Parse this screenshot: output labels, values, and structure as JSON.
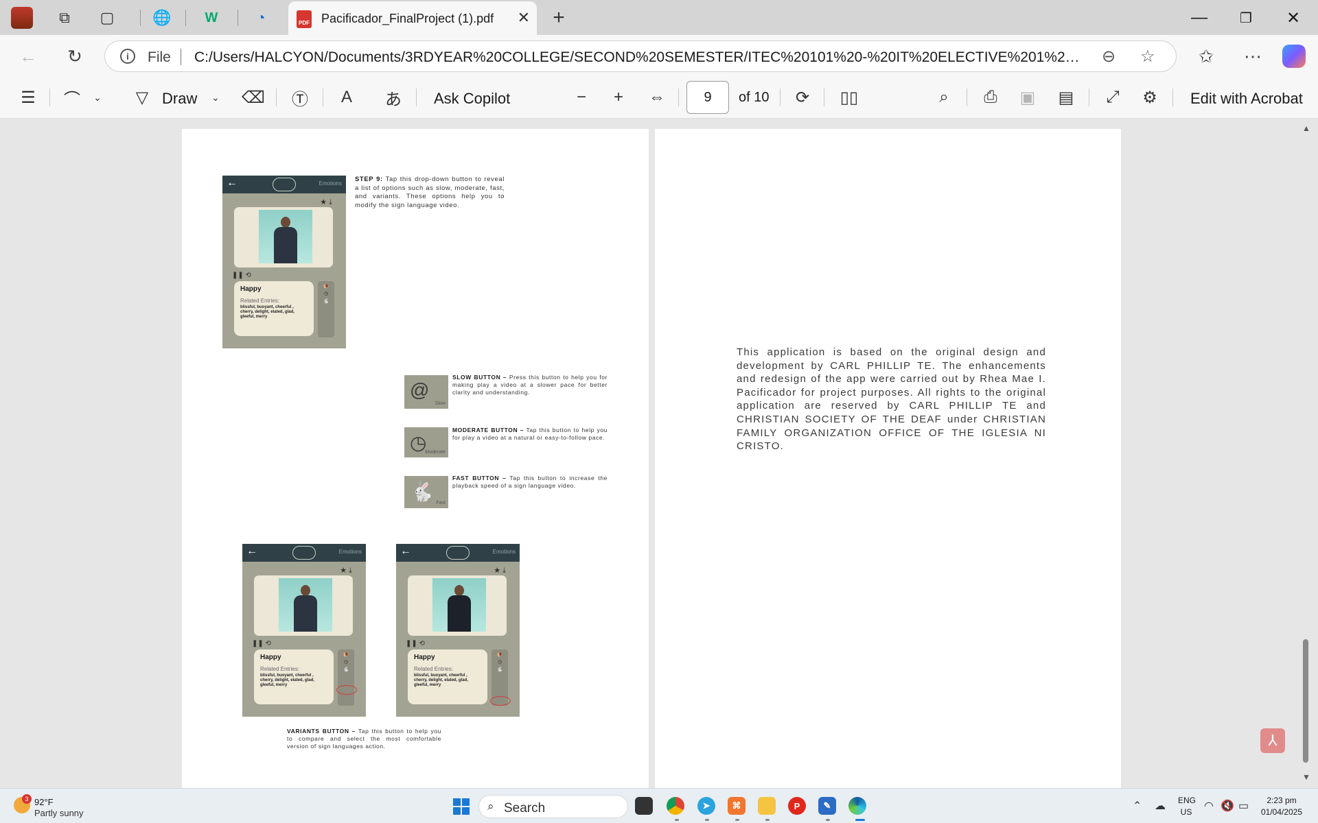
{
  "tab": {
    "title": "Pacificador_FinalProject (1).pdf",
    "close": "✕",
    "new_tab": "+"
  },
  "address": {
    "file_label": "File",
    "url": "C:/Users/HALCYON/Documents/3RDYEAR%20COLLEGE/SECOND%20SEMESTER/ITEC%20101%20-%20IT%20ELECTIVE%201%20(HUMAN..."
  },
  "pdf_toolbar": {
    "draw_label": "Draw",
    "ask_copilot": "Ask Copilot",
    "page_current": "9",
    "page_total": "of 10",
    "edit_acrobat": "Edit with Acrobat"
  },
  "page_left": {
    "phone_header_label": "Emotions",
    "card_title": "Happy",
    "card_sub": "Related Entries:",
    "card_words": "blissful, buoyant, cheerful , cherry, delight, elated, glad, gleeful, merry",
    "step9_label": "STEP 9:",
    "step9_text": " Tap this drop-down button to reveal a list of options such as slow, moderate, fast, and variants. These options help you to modify the sign language video.",
    "slow_label": "SLOW BUTTON –",
    "slow_text": " Press this button  to help you for  making play a video at a slower pace for better clarity and understanding.",
    "slow_thumb": "Slow",
    "moderate_label": "MODERATE BUTTON –",
    "moderate_text": " Tap this button  to help you for play a video at a natural or easy-to-follow pace.",
    "moderate_thumb": "Moderate",
    "fast_label": "FAST BUTTON –",
    "fast_text": " Tap this button  to increase the playback speed of a sign language video.",
    "fast_thumb": "Fast",
    "variants_label": "VARIANTS BUTTON –",
    "variants_text": " Tap this button  to help you to compare and select the most comfortable version of sign languages action."
  },
  "page_right": {
    "credit": "This application is based on the original design and development by CARL PHILLIP TE. The enhancements and redesign of the app were carried out by Rhea Mae I. Pacificador for project purposes. All rights to the original application are reserved by CARL PHILLIP TE and  CHRISTIAN SOCIETY OF THE DEAF under CHRISTIAN FAMILY ORGANIZATION OFFICE OF THE IGLESIA NI CRISTO."
  },
  "taskbar": {
    "weather_badge": "3",
    "weather_temp": "92°F",
    "weather_desc": "Partly sunny",
    "search": "Search",
    "lang_1": "ENG",
    "lang_2": "US",
    "time": "2:23 pm",
    "date": "01/04/2025"
  }
}
